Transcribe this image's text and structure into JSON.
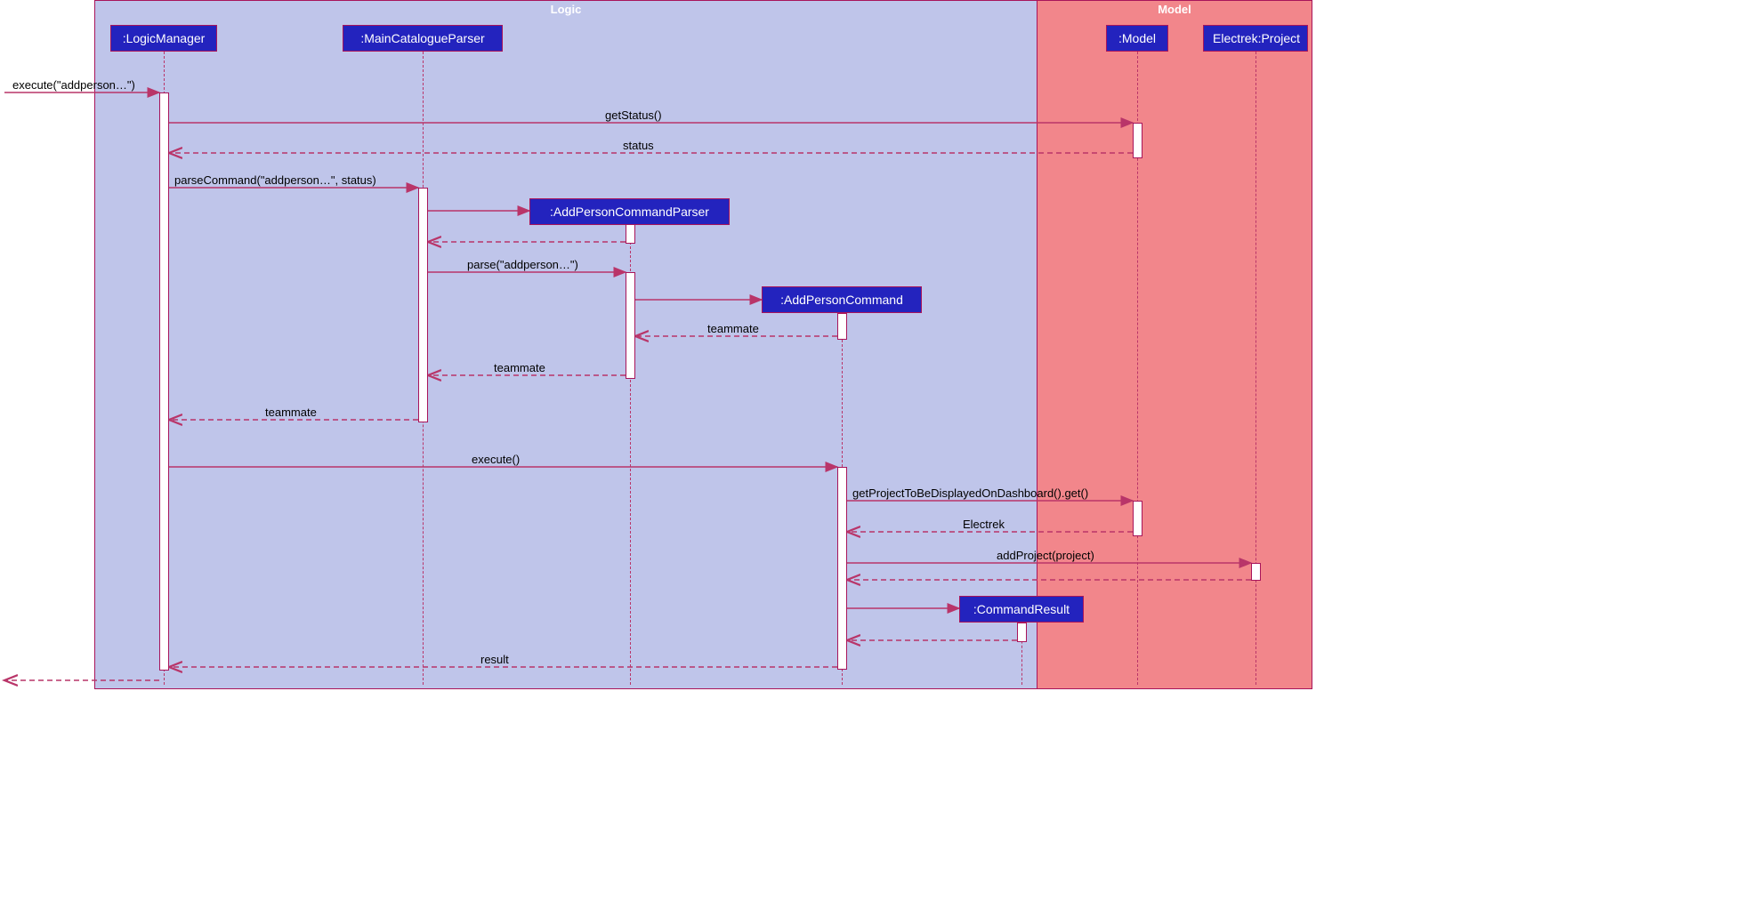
{
  "groups": {
    "logic": "Logic",
    "model": "Model"
  },
  "participants": {
    "logicManager": ":LogicManager",
    "mainCatalogueParser": ":MainCatalogueParser",
    "addPersonCommandParser": ":AddPersonCommandParser",
    "addPersonCommand": ":AddPersonCommand",
    "commandResult": ":CommandResult",
    "model": ":Model",
    "electrekProject": "Electrek:Project"
  },
  "messages": {
    "execute1": "execute(\"addperson…\")",
    "getStatus": "getStatus()",
    "status": "status",
    "parseCommand": "parseCommand(\"addperson…\", status)",
    "parse": "parse(\"addperson…\")",
    "teammate1": "teammate",
    "teammate2": "teammate",
    "teammate3": "teammate",
    "execute2": "execute()",
    "getProject": "getProjectToBeDisplayedOnDashboard().get()",
    "electrek": "Electrek",
    "addProject": "addProject(project)",
    "result": "result"
  }
}
